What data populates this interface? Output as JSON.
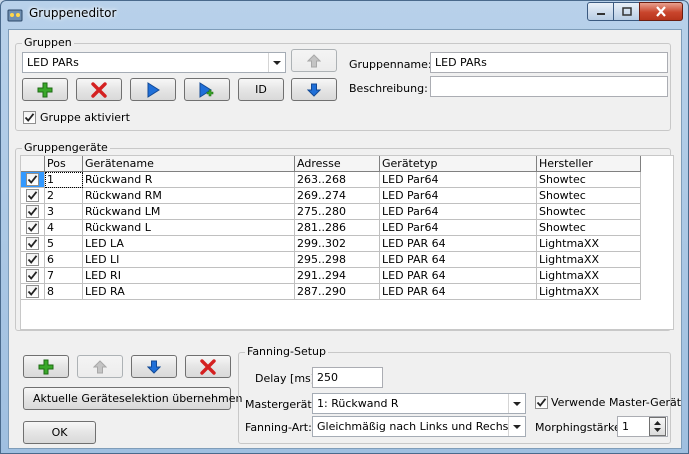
{
  "window": {
    "title": "Gruppeneditor"
  },
  "gruppen": {
    "group_label": "Gruppen",
    "selected_group": "LED PARs",
    "id_label": "ID",
    "name_label": "Gruppenname:",
    "name_value": "LED PARs",
    "desc_label": "Beschreibung:",
    "desc_value": "",
    "active_label": "Gruppe aktiviert",
    "active_checked": true
  },
  "devices": {
    "group_label": "Gruppengeräte",
    "columns": [
      "Pos",
      "Gerätename",
      "Adresse",
      "Gerätetyp",
      "Hersteller"
    ],
    "rows": [
      {
        "checked": true,
        "pos": "1",
        "name": "Rückwand R",
        "address": "263..268",
        "type": "LED Par64",
        "maker": "Showtec"
      },
      {
        "checked": true,
        "pos": "2",
        "name": "Rückwand RM",
        "address": "269..274",
        "type": "LED Par64",
        "maker": "Showtec"
      },
      {
        "checked": true,
        "pos": "3",
        "name": "Rückwand LM",
        "address": "275..280",
        "type": "LED Par64",
        "maker": "Showtec"
      },
      {
        "checked": true,
        "pos": "4",
        "name": "Rückwand L",
        "address": "281..286",
        "type": "LED Par64",
        "maker": "Showtec"
      },
      {
        "checked": true,
        "pos": "5",
        "name": "LED LA",
        "address": "299..302",
        "type": "LED PAR 64",
        "maker": "LightmaXX"
      },
      {
        "checked": true,
        "pos": "6",
        "name": "LED LI",
        "address": "295..298",
        "type": "LED PAR 64",
        "maker": "LightmaXX"
      },
      {
        "checked": true,
        "pos": "7",
        "name": "LED RI",
        "address": "291..294",
        "type": "LED PAR 64",
        "maker": "LightmaXX"
      },
      {
        "checked": true,
        "pos": "8",
        "name": "LED RA",
        "address": "287..290",
        "type": "LED PAR 64",
        "maker": "LightmaXX"
      }
    ]
  },
  "bottom": {
    "take_selection_label": "Aktuelle Geräteselektion übernehmen",
    "ok_label": "OK"
  },
  "fanning": {
    "group_label": "Fanning-Setup",
    "delay_label": "Delay [ms]:",
    "delay_value": "250",
    "master_label": "Mastergerät:",
    "master_value": "1: Rückwand R",
    "use_master_label": "Verwende Master-Gerät",
    "use_master_checked": true,
    "art_label": "Fanning-Art:",
    "art_value": "Gleichmäßig nach Links und Rechs",
    "morph_label": "Morphingstärke:",
    "morph_value": "1"
  },
  "colors": {
    "selection": "#3399ff",
    "add_green": "#3aa82a",
    "delete_red": "#d42020",
    "play_blue": "#1f6fd8"
  }
}
